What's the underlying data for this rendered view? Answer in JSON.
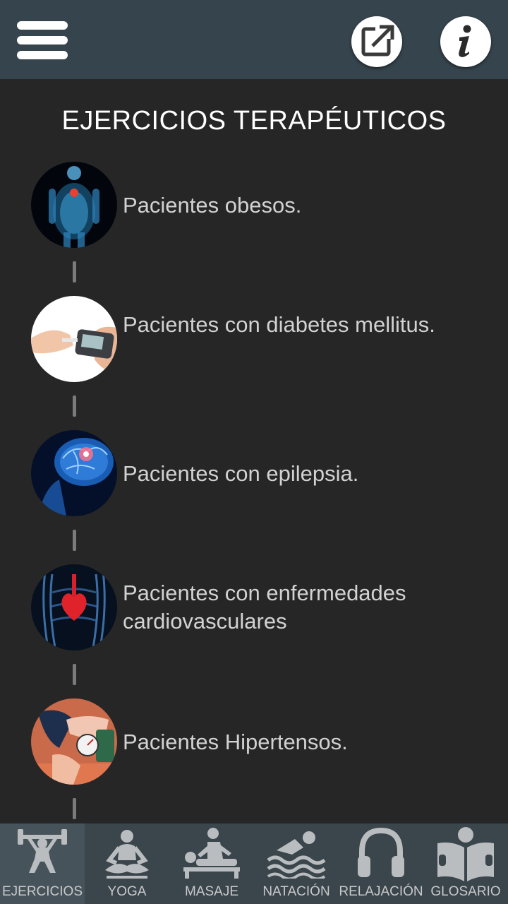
{
  "header": {
    "menu_icon": "hamburger-menu-icon",
    "share_icon": "open-external-icon",
    "info_icon": "info-icon"
  },
  "page": {
    "title": "EJERCICIOS TERAPÉUTICOS"
  },
  "items": [
    {
      "label": "Pacientes obesos.",
      "image": "obese-body-xray-image"
    },
    {
      "label": "Pacientes con diabetes mellitus.",
      "image": "glucose-meter-image"
    },
    {
      "label": "Pacientes con epilepsia.",
      "image": "brain-image"
    },
    {
      "label": "Pacientes con enfermedades cardiovasculares",
      "image": "heart-chest-image"
    },
    {
      "label": "Pacientes Hipertensos.",
      "image": "blood-pressure-image"
    }
  ],
  "tabs": [
    {
      "label": "EJERCICIOS",
      "icon": "weightlifter-icon"
    },
    {
      "label": "YOGA",
      "icon": "yoga-icon"
    },
    {
      "label": "MASAJE",
      "icon": "massage-icon"
    },
    {
      "label": "NATACIÓN",
      "icon": "swimmer-icon"
    },
    {
      "label": "RELAJACIÓN",
      "icon": "headphones-icon"
    },
    {
      "label": "GLOSARIO",
      "icon": "reading-book-icon"
    }
  ],
  "colors": {
    "topbar": "#36444d",
    "background": "#262626",
    "bottombar": "#3a454c",
    "item_text": "#d2d2d2",
    "icon_grey": "#b9bdbf"
  }
}
